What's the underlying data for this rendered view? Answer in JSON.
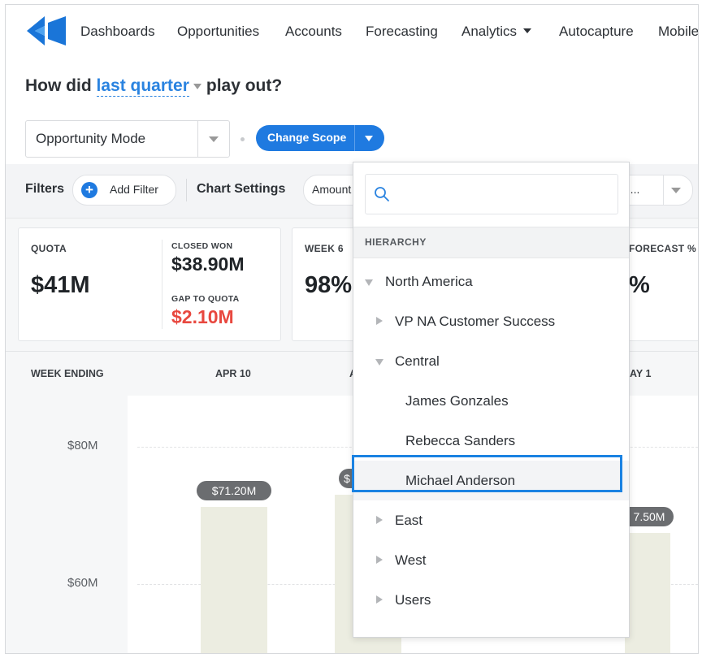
{
  "nav": {
    "items": [
      "Dashboards",
      "Opportunities",
      "Accounts",
      "Forecasting",
      "Analytics",
      "Autocapture",
      "Mobile"
    ]
  },
  "question": {
    "prefix": "How did",
    "period": "last quarter",
    "suffix": "play out?"
  },
  "mode": {
    "selected": "Opportunity Mode",
    "scope_button": "Change Scope"
  },
  "filters": {
    "label": "Filters",
    "add_filter": "Add Filter",
    "chart_settings": "Chart Settings",
    "amount": "Amount",
    "right_select": "te..."
  },
  "kpis": {
    "quota_label": "QUOTA",
    "quota_value": "$41M",
    "closed_won_label": "CLOSED WON",
    "closed_won_value": "$38.90M",
    "gap_label": "GAP TO QUOTA",
    "gap_value": "$2.10M",
    "week_label": "WEEK 6",
    "week_value": "98%",
    "forecast_label": "FORECAST %",
    "forecast_value": "%"
  },
  "table": {
    "week_ending": "WEEK ENDING",
    "col1": "APR 10",
    "col2": "A",
    "col3": "AY 1"
  },
  "chart_data": {
    "type": "bar",
    "categories": [
      "APR 10",
      "A",
      "AY 1"
    ],
    "values": [
      71.2,
      null,
      67.5
    ],
    "data_labels": [
      "$71.20M",
      "$",
      "7.50M"
    ],
    "ytick_labels": [
      "$80M",
      "$60M"
    ],
    "y_ticks": [
      80,
      60
    ],
    "ylim": [
      55,
      85
    ]
  },
  "dropdown": {
    "search_placeholder": "",
    "section": "HIERARCHY",
    "items": [
      {
        "label": "North America",
        "expanded": true
      },
      {
        "label": "VP NA Customer Success",
        "expanded": false
      },
      {
        "label": "Central",
        "expanded": true
      },
      {
        "label": "James Gonzales"
      },
      {
        "label": "Rebecca Sanders"
      },
      {
        "label": "Michael Anderson",
        "selected": true
      },
      {
        "label": "East",
        "expanded": false
      },
      {
        "label": "West",
        "expanded": false
      },
      {
        "label": "Users",
        "expanded": false
      }
    ]
  },
  "colors": {
    "accent": "#1f7ae0",
    "gap": "#e8483f",
    "bar": "#ecede1",
    "highlight": "#1a82e2"
  }
}
